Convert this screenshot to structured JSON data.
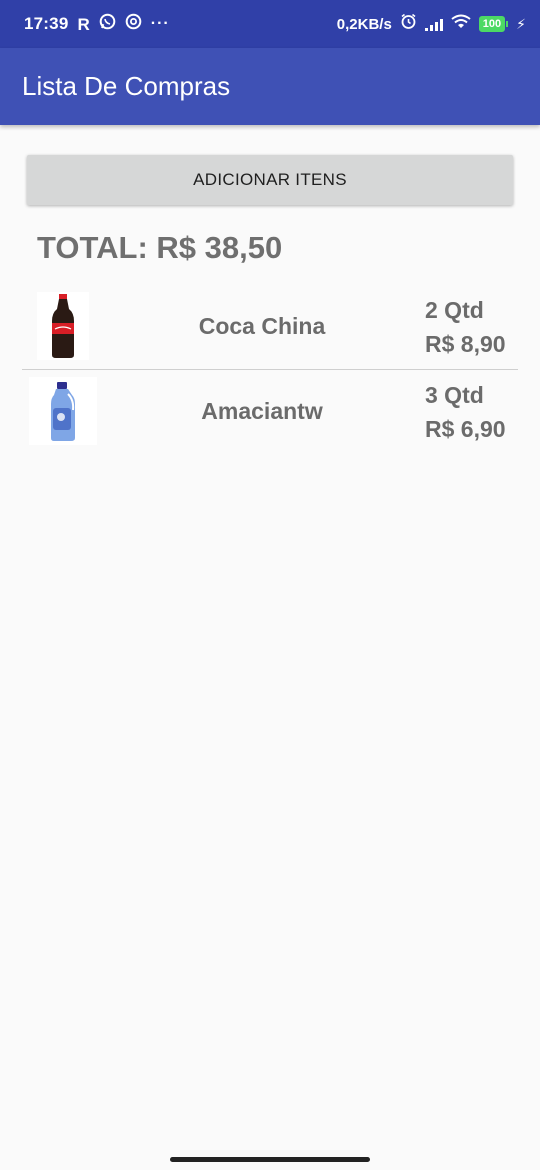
{
  "status_bar": {
    "time": "17:39",
    "net_speed": "0,2KB/s",
    "battery_level": "100",
    "icons": [
      "r-icon",
      "whatsapp-icon",
      "at-circle-icon",
      "more-dots-icon",
      "alarm-icon",
      "signal-icon",
      "wifi-icon",
      "battery-icon",
      "charging-bolt-icon"
    ]
  },
  "app_bar": {
    "title": "Lista De Compras"
  },
  "add_button": {
    "label": "ADICIONAR ITENS"
  },
  "total": {
    "label": "TOTAL: R$ 38,50"
  },
  "items": [
    {
      "name": "Coca China",
      "qty": "2 Qtd",
      "price": "R$ 8,90",
      "image": "soda-bottle-image"
    },
    {
      "name": "Amaciantw",
      "qty": "3 Qtd",
      "price": "R$ 6,90",
      "image": "softener-bottle-image"
    }
  ],
  "colors": {
    "status_bar": "#3040a8",
    "app_bar": "#3f51b5",
    "background": "#fafafa",
    "button": "#d6d7d7",
    "text_gray": "#6b6b6b"
  }
}
